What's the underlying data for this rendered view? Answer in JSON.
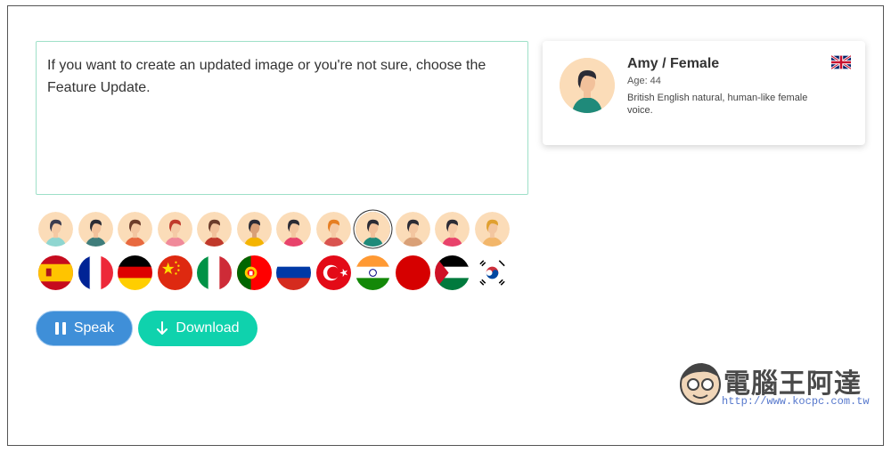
{
  "editor": {
    "text": "If you want to create an updated image or you're not sure, choose the Feature Update."
  },
  "voice_card": {
    "name": "Amy / Female",
    "age": "Age: 44",
    "description": "British English natural, human-like female voice.",
    "flag_icon": "uk-flag-icon"
  },
  "avatars": [
    {
      "icon": "avatar-1-icon",
      "hair": "#3b3b4f",
      "shirt": "#8fd6d0",
      "skin": "#f5c9a3"
    },
    {
      "icon": "avatar-2-icon",
      "hair": "#2b2b35",
      "shirt": "#3f7d7b",
      "skin": "#f2c19b"
    },
    {
      "icon": "avatar-3-icon",
      "hair": "#6b3b2a",
      "shirt": "#e8693f",
      "skin": "#f3c6a0"
    },
    {
      "icon": "avatar-4-icon",
      "hair": "#c0392b",
      "shirt": "#f08a9a",
      "skin": "#f5caa6"
    },
    {
      "icon": "avatar-5-icon",
      "hair": "#6b3b2a",
      "shirt": "#c0392b",
      "skin": "#f2c19b"
    },
    {
      "icon": "avatar-6-icon",
      "hair": "#2b2b35",
      "shirt": "#f4b400",
      "skin": "#d9a077"
    },
    {
      "icon": "avatar-7-icon",
      "hair": "#2b2b35",
      "shirt": "#e8436b",
      "skin": "#f3c6a0"
    },
    {
      "icon": "avatar-8-icon",
      "hair": "#e67e22",
      "shirt": "#d9534f",
      "skin": "#f5caa6"
    },
    {
      "icon": "avatar-9-icon",
      "hair": "#2b2b35",
      "shirt": "#1f8a7a",
      "skin": "#f2c19b",
      "selected": true
    },
    {
      "icon": "avatar-10-icon",
      "hair": "#2b2b35",
      "shirt": "#d9a077",
      "skin": "#f3c6a0"
    },
    {
      "icon": "avatar-11-icon",
      "hair": "#2b2b35",
      "shirt": "#e8436b",
      "skin": "#f5caa6"
    },
    {
      "icon": "avatar-12-icon",
      "hair": "#e0a030",
      "shirt": "#f2b66a",
      "skin": "#f3c6a0"
    }
  ],
  "flags": [
    "spain-flag-icon",
    "france-flag-icon",
    "germany-flag-icon",
    "china-flag-icon",
    "italy-flag-icon",
    "portugal-flag-icon",
    "russia-flag-icon",
    "turkey-flag-icon",
    "india-flag-icon",
    "japan-flag-icon",
    "arab-flag-icon",
    "korea-flag-icon"
  ],
  "buttons": {
    "speak_label": "Speak",
    "speak_icon": "pause-icon",
    "download_label": "Download",
    "download_icon": "arrow-down-icon"
  },
  "watermark": {
    "title": "電腦王阿達",
    "url": "http://www.kocpc.com.tw"
  },
  "colors": {
    "speak": "#3f8fd8",
    "download": "#0fd2ad",
    "textarea_border": "#9ee0c8"
  }
}
